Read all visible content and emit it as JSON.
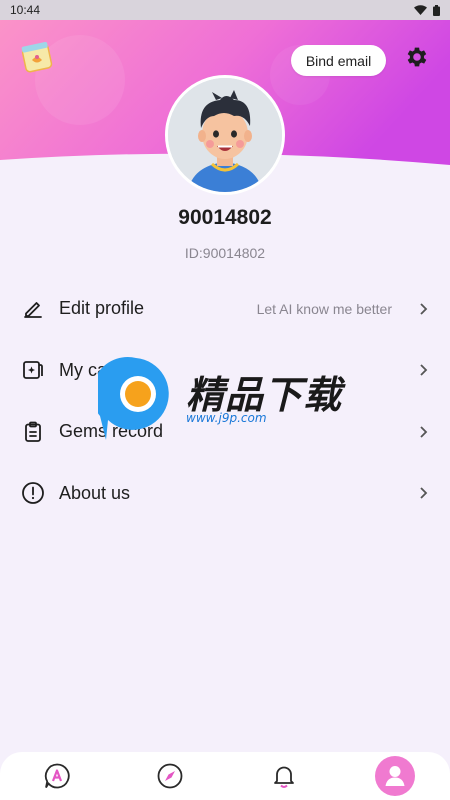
{
  "status_bar": {
    "time": "10:44"
  },
  "header": {
    "bind_email_label": "Bind email"
  },
  "profile": {
    "username": "90014802",
    "id_text": "ID:90014802"
  },
  "menu": {
    "items": [
      {
        "label": "Edit profile",
        "hint": "Let AI know me better",
        "icon": "edit-icon"
      },
      {
        "label": "My cards",
        "hint": "",
        "icon": "card-sparkle-icon"
      },
      {
        "label": "Gems record",
        "hint": "",
        "icon": "clipboard-icon"
      },
      {
        "label": "About us",
        "hint": "",
        "icon": "info-icon"
      }
    ]
  },
  "watermark": {
    "title": "精品下载",
    "url": "www.j9p.com"
  },
  "bottom_nav": {
    "items": [
      "chat-a-icon",
      "compass-icon",
      "bell-icon",
      "profile-icon"
    ],
    "active_index": 3
  },
  "colors": {
    "header_gradient_start": "#f98cc6",
    "header_gradient_end": "#d44be0",
    "active_nav": "#f07ad0",
    "background": "#f5f0fb"
  }
}
